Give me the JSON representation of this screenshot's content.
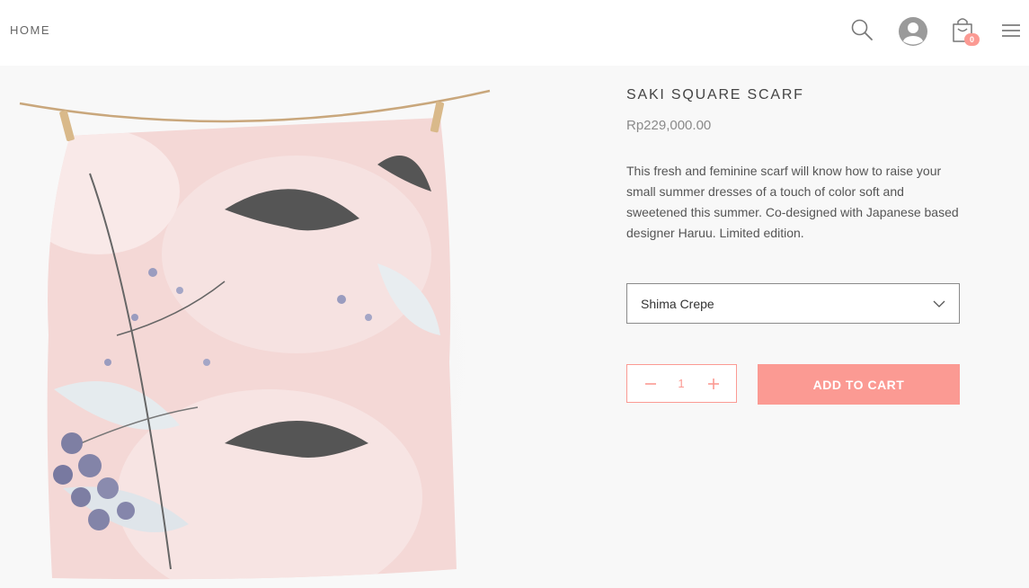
{
  "header": {
    "home_label": "HOME",
    "cart_count": "0",
    "icons": [
      "search-icon",
      "account-icon",
      "cart-icon",
      "menu-icon"
    ]
  },
  "product": {
    "title": "SAKI SQUARE SCARF",
    "price": "Rp229,000.00",
    "description": "This fresh and feminine scarf will know how to raise your small summer dresses of a touch of color soft and sweetened this summer. Co-designed with Japanese based designer Haruu. Limited edition.",
    "variant_selected": "Shima Crepe",
    "quantity": "1",
    "add_to_cart_label": "ADD TO CART"
  },
  "colors": {
    "accent": "#fb9a93",
    "header_bg": "#ffffff",
    "page_bg": "#f8f8f8"
  }
}
